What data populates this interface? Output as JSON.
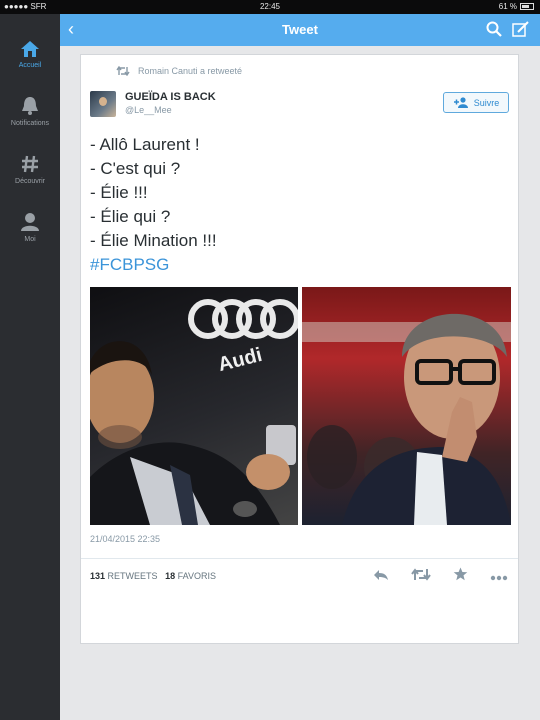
{
  "status": {
    "carrier": "●●●●● SFR",
    "time": "22:45",
    "battery": "61 %"
  },
  "sidebar": {
    "items": [
      {
        "label": "Accueil",
        "icon": "home-icon",
        "active": true
      },
      {
        "label": "Notifications",
        "icon": "bell-icon",
        "active": false
      },
      {
        "label": "Découvrir",
        "icon": "hashtag-icon",
        "active": false
      },
      {
        "label": "Moi",
        "icon": "person-icon",
        "active": false
      }
    ]
  },
  "nav": {
    "title": "Tweet",
    "back": "‹"
  },
  "retweet": {
    "text": "Romain Canuti a retweeté"
  },
  "author": {
    "name": "GUEÏDA IS BACK",
    "handle": "@Le__Mee"
  },
  "follow": {
    "label": "Suivre"
  },
  "tweet": {
    "lines": [
      "- Allô Laurent !",
      "- C'est qui ?",
      "- Élie !!!",
      "- Élie qui ?",
      "- Élie Mination !!!"
    ],
    "hashtag": "#FCBPSG"
  },
  "media": {
    "logo_text": "Audi"
  },
  "meta": {
    "timestamp": "21/04/2015 22:35"
  },
  "stats": {
    "retweets_count": "131",
    "retweets_label": "RETWEETS",
    "favorites_count": "18",
    "favorites_label": "FAVORIS"
  },
  "colors": {
    "accent": "#55acee",
    "link": "#3b94d9",
    "sidebar": "#2b2d31"
  }
}
